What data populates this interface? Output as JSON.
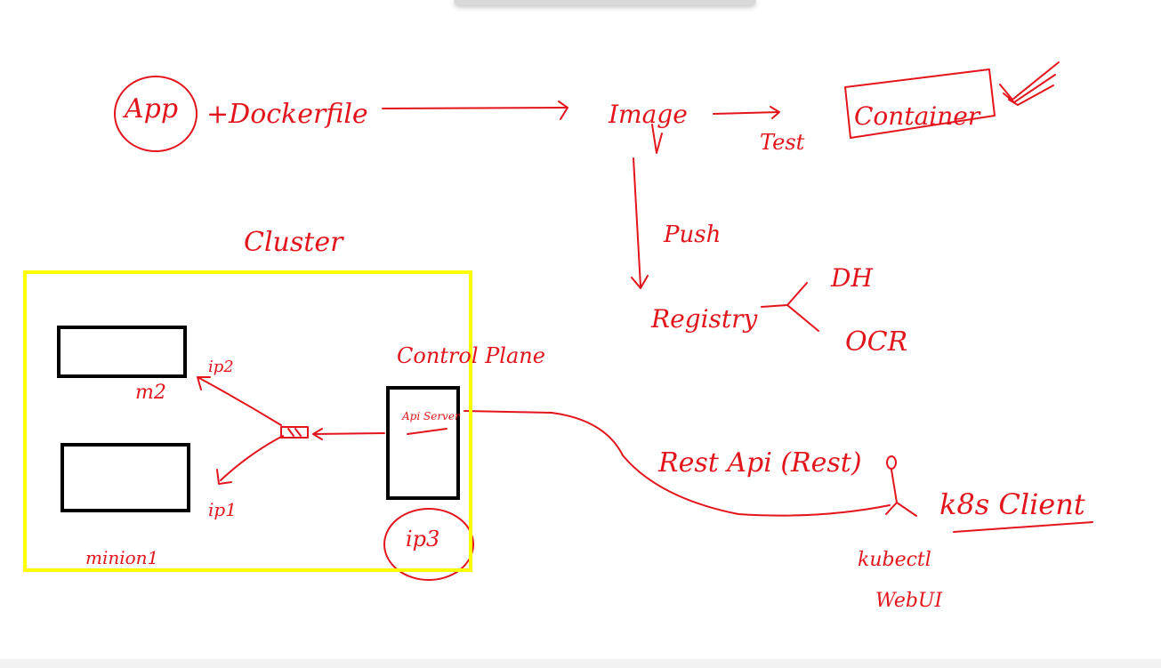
{
  "colors": {
    "ink": "#e3151c",
    "cluster_border": "#ffff00",
    "box": "#000000"
  },
  "labels": {
    "app": "App",
    "dockerfile": "+Dockerfile",
    "image": "Image",
    "test": "Test",
    "container": "Container",
    "push": "Push",
    "registry": "Registry",
    "dh": "DH",
    "ocr": "OCR",
    "cluster": "Cluster",
    "control_plane": "Control Plane",
    "api_server": "Api Server",
    "m2": "m2",
    "ip2": "ip2",
    "ip1": "ip1",
    "ip3": "ip3",
    "minion1": "minion1",
    "rest_api": "Rest Api (Rest)",
    "k8s_client": "k8s Client",
    "kubectl": "kubectl",
    "webui": "WebUI"
  }
}
